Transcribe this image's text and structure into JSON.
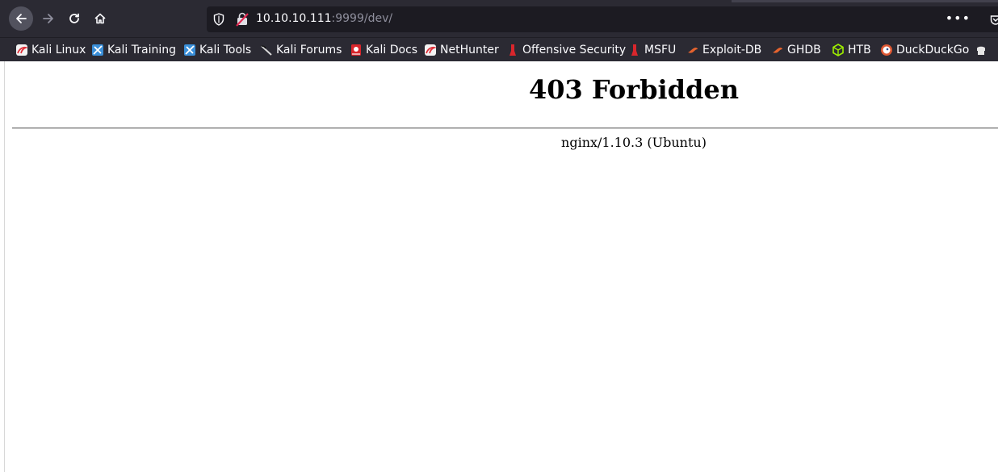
{
  "browser": {
    "url_host": "10.10.10.111",
    "url_rest": ":9999/dev/",
    "more_label": "•••"
  },
  "bookmarks": [
    {
      "label": "Kali Linux",
      "icon": "kali-dragon-icon",
      "color": "#e0303a"
    },
    {
      "label": "Kali Training",
      "icon": "kali-training-icon",
      "color": "#3a8fd9"
    },
    {
      "label": "Kali Tools",
      "icon": "kali-tools-icon",
      "color": "#3a8fd9"
    },
    {
      "label": "Kali Forums",
      "icon": "kali-forums-icon",
      "color": "#d8d8d8"
    },
    {
      "label": "Kali Docs",
      "icon": "kali-docs-icon",
      "color": "#d9262c"
    },
    {
      "label": "NetHunter",
      "icon": "nethunter-icon",
      "color": "#e0303a"
    },
    {
      "label": "Offensive Security",
      "icon": "offsec-icon",
      "color": "#d9262c"
    },
    {
      "label": "MSFU",
      "icon": "msfu-icon",
      "color": "#d9262c"
    },
    {
      "label": "Exploit-DB",
      "icon": "exploit-db-icon",
      "color": "#e5632e"
    },
    {
      "label": "GHDB",
      "icon": "ghdb-icon",
      "color": "#e5632e"
    },
    {
      "label": "HTB",
      "icon": "htb-icon",
      "color": "#9fef00"
    },
    {
      "label": "DuckDuckGo",
      "icon": "duckduckgo-icon",
      "color": "#de5833"
    }
  ],
  "content": {
    "title": "403 Forbidden",
    "server": "nginx/1.10.3 (Ubuntu)"
  }
}
